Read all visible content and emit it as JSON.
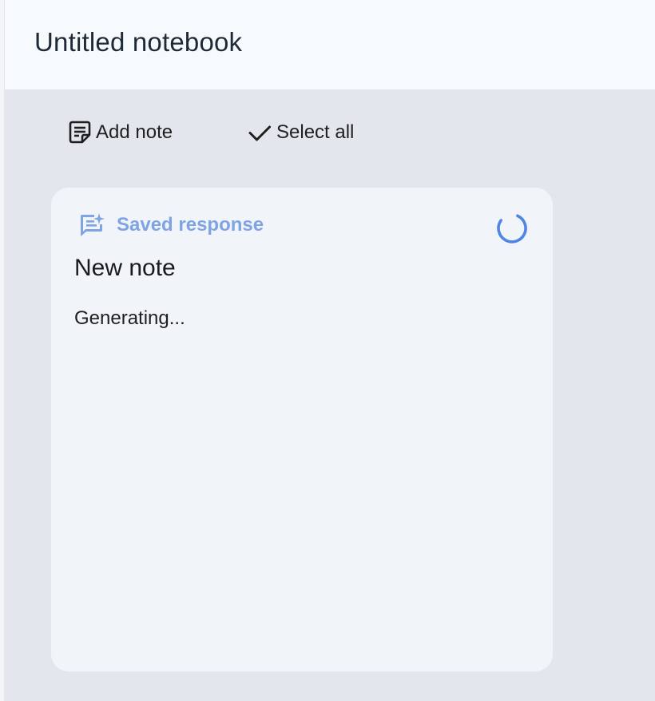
{
  "header": {
    "title": "Untitled notebook"
  },
  "toolbar": {
    "add_note_label": "Add note",
    "add_note_icon": "note-add-icon",
    "select_all_label": "Select all",
    "select_all_icon": "checkmark-icon"
  },
  "note_card": {
    "meta_label": "Saved response",
    "meta_icon": "saved-response-icon",
    "meta_color": "#7ea4e3",
    "status_icon": "loading-spinner-icon",
    "title": "New note",
    "body": "Generating..."
  },
  "colors": {
    "page_background": "#e3e6ec",
    "header_background": "#f7fafd",
    "card_background": "#f1f5f9",
    "accent": "#4f86e4"
  }
}
